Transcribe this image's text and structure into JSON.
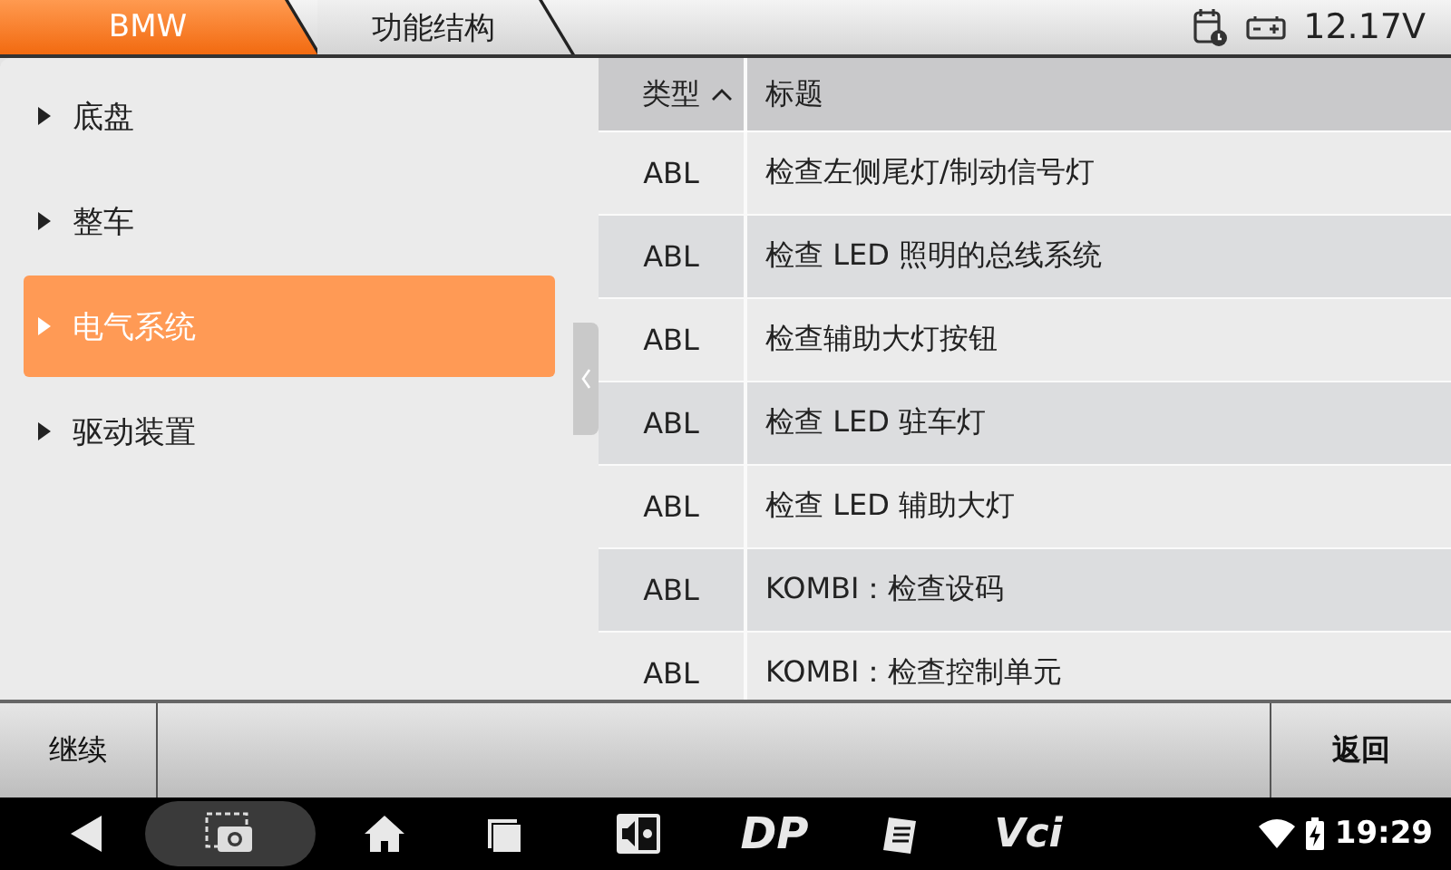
{
  "breadcrumbs": [
    {
      "label": "BMW",
      "selected": true
    },
    {
      "label": "功能结构",
      "selected": false
    }
  ],
  "status": {
    "voltage": "12.17V"
  },
  "menu": [
    {
      "label": "底盘",
      "selected": false
    },
    {
      "label": "整车",
      "selected": false
    },
    {
      "label": "电气系统",
      "selected": true
    },
    {
      "label": "驱动装置",
      "selected": false
    }
  ],
  "table": {
    "columns": [
      {
        "label": "类型",
        "sorted_ascending": true
      },
      {
        "label": "标题"
      }
    ],
    "rows": [
      [
        "ABL",
        "检查左侧尾灯/制动信号灯"
      ],
      [
        "ABL",
        "检查 LED 照明的总线系统"
      ],
      [
        "ABL",
        "检查辅助大灯按钮"
      ],
      [
        "ABL",
        "检查 LED 驻车灯"
      ],
      [
        "ABL",
        "检查 LED 辅助大灯"
      ],
      [
        "ABL",
        "KOMBI：检查设码"
      ],
      [
        "ABL",
        "KOMBI：检查控制单元"
      ]
    ]
  },
  "buttons": [
    {
      "label": "继续"
    },
    {
      "label": "返回"
    }
  ],
  "navbar": {
    "apps": [
      {
        "kind": "logo",
        "label": "DP"
      },
      {
        "kind": "logo",
        "label": "Vci"
      }
    ],
    "time": "19:29"
  }
}
